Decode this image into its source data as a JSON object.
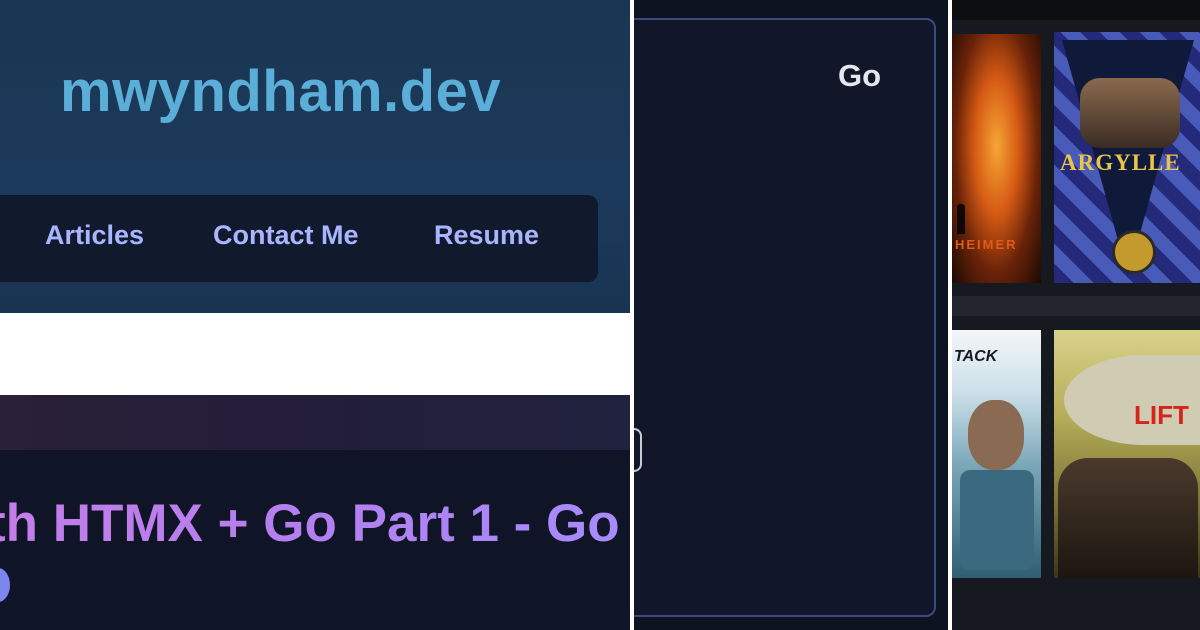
{
  "site": {
    "title": "mwyndham.dev",
    "nav": {
      "articles": "Articles",
      "contact": "Contact Me",
      "resume": "Resume"
    }
  },
  "article": {
    "title_fragment": "th HTMX + Go Part 1 - Go"
  },
  "code_card": {
    "language_label": "Go"
  },
  "posters": {
    "oppenheimer_caption": "HEIMER",
    "argylle_caption": "ARGYLLE",
    "attack_caption": "TACK",
    "lift_caption": "LIFT"
  },
  "colors": {
    "header_bg": "#1c3a5c",
    "site_title": "#5aaed8",
    "nav_link": "#a9b5ff",
    "nav_bg": "#111a2d",
    "article_title_gradient": [
      "#c47ee8",
      "#a78bfa"
    ],
    "code_card_border": "#3c4a80",
    "argylle_gold": "#e9c54e",
    "lift_red": "#d62418"
  }
}
